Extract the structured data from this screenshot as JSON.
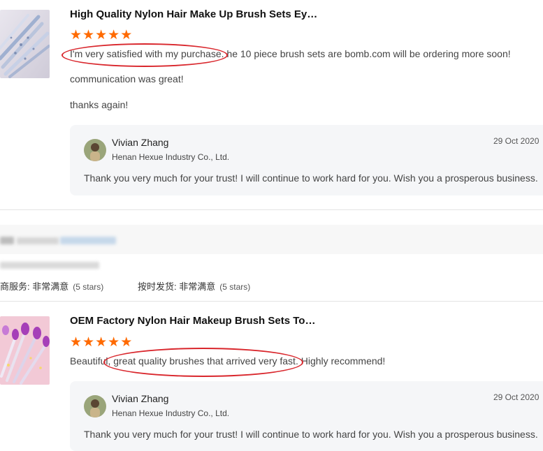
{
  "reviews": [
    {
      "title": "High Quality Nylon Hair Make Up Brush Sets Ey…",
      "rating": 5,
      "comment_lines": [
        "I'm very satisfied with my purchase. he 10 piece brush sets are bomb.com will be ordering more soon!",
        "communication was great!",
        "thanks again!"
      ],
      "reply": {
        "name": "Vivian Zhang",
        "company": "Henan Hexue Industry Co., Ltd.",
        "date": "29 Oct 2020",
        "text": "Thank you very much for your trust! I will continue to work hard for you. Wish you a prosperous business."
      }
    },
    {
      "title": "OEM Factory Nylon Hair Makeup Brush Sets To…",
      "rating": 5,
      "comment_lines": [
        "Beautiful, great quality brushes that arrived very fast. Highly recommend!"
      ],
      "reply": {
        "name": "Vivian Zhang",
        "company": "Henan Hexue Industry Co., Ltd.",
        "date": "29 Oct 2020",
        "text": "Thank you very much for your trust! I will continue to work hard for you. Wish you a prosperous business."
      }
    }
  ],
  "supplier_ratings": {
    "service_label": "商服务: 非常满意",
    "service_stars": "(5 stars)",
    "delivery_label": "按时发货: 非常满意",
    "delivery_stars": "(5 stars)"
  },
  "colors": {
    "star": "#ff6a00",
    "annotation": "#d9262c",
    "reply_bg": "#f5f6f8"
  },
  "icons": [
    "star-icon",
    "avatar"
  ]
}
